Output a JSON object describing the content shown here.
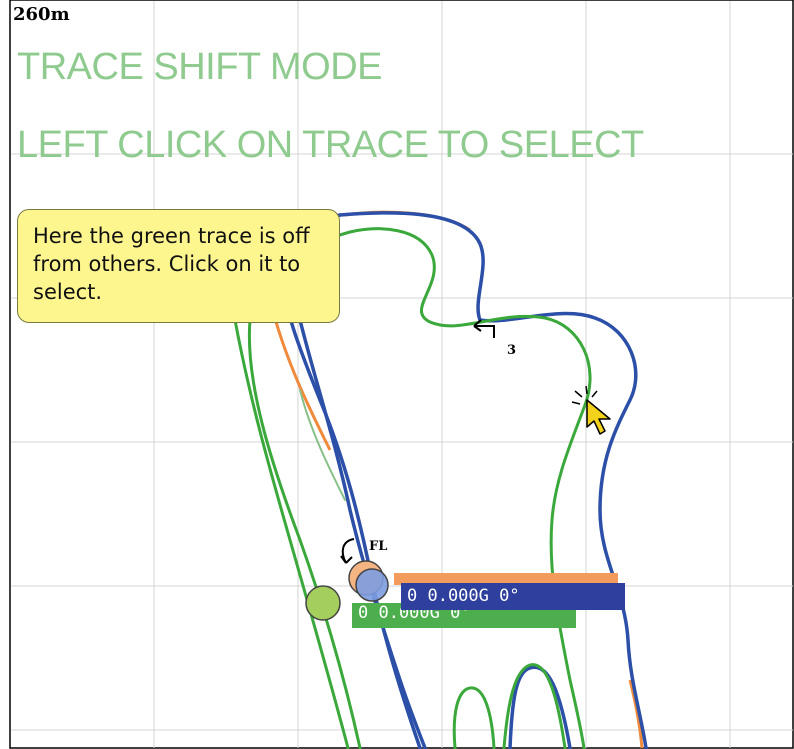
{
  "scale": {
    "label": "260m"
  },
  "mode": {
    "title": "TRACE SHIFT MODE",
    "instruction": "LEFT CLICK ON TRACE TO SELECT"
  },
  "callout": {
    "text": "Here the green trace is off from others. Click on it to select."
  },
  "markers": {
    "corner_label": "FL",
    "turn_number": "3"
  },
  "readouts": {
    "blue": "0 0.000G 0°",
    "green": "0 0.000G 0°"
  },
  "colors": {
    "grid": "#d4d4d4",
    "blue_trace": "#2c4fa8",
    "green_trace": "#3aa83a",
    "orange_trace": "#f08a3c",
    "mode_text": "#8fcb8f",
    "callout_bg": "#fdf68f"
  },
  "icons": [
    "mouse-pointer-icon",
    "turn-arrow-icon",
    "car-position-marker-icon"
  ]
}
